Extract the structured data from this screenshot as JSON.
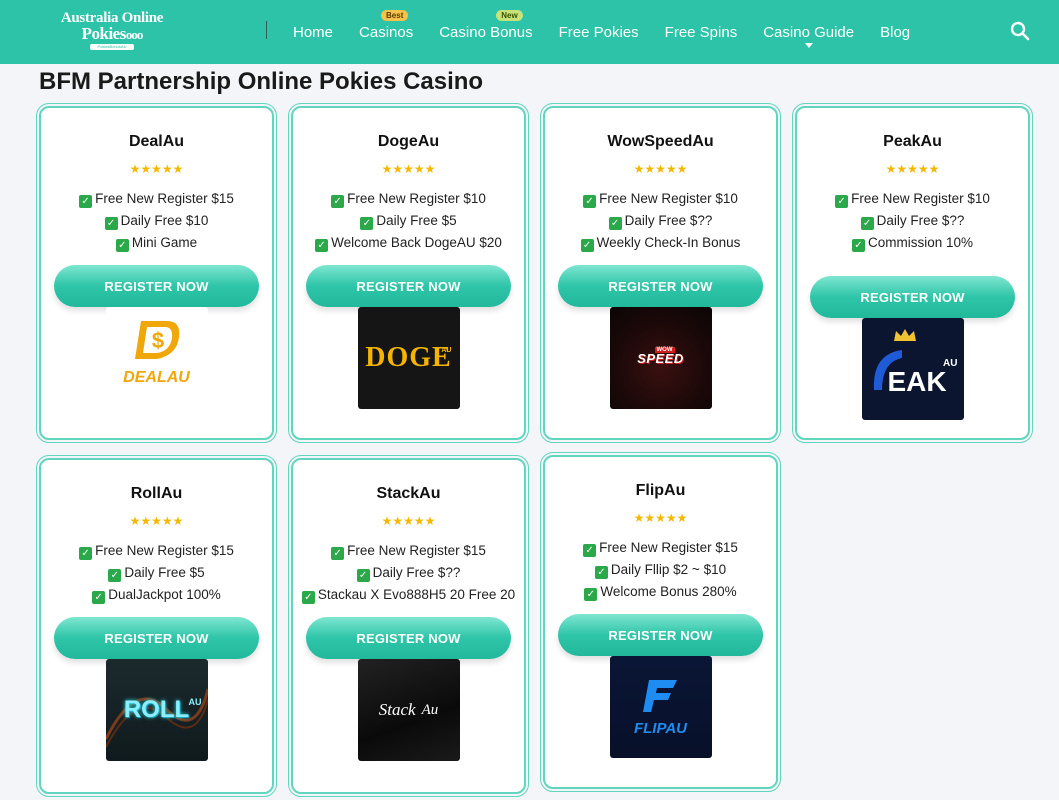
{
  "header": {
    "logo": {
      "line1": "Australia Online",
      "line2": "Pokies",
      "dots": "ooo",
      "tagline": "PokiesBonusAU"
    },
    "nav": [
      {
        "label": "Home",
        "badge": ""
      },
      {
        "label": "Casinos",
        "badge": "Best"
      },
      {
        "label": "Casino Bonus",
        "badge": "New"
      },
      {
        "label": "Free Pokies",
        "badge": ""
      },
      {
        "label": "Free Spins",
        "badge": ""
      },
      {
        "label": "Casino Guide",
        "badge": ""
      },
      {
        "label": "Blog",
        "badge": ""
      }
    ]
  },
  "page_title": "BFM Partnership Online Pokies Casino",
  "stars": "★★★★★",
  "check": "✓",
  "register_label": "REGISTER NOW",
  "cards": [
    {
      "name": "DealAu",
      "features": [
        "Free New Register $15",
        "Daily Free $10",
        "Mini Game"
      ],
      "logo_text": "DEALAU"
    },
    {
      "name": "DogeAu",
      "features": [
        "Free New Register $10",
        "Daily Free $5",
        "Welcome Back DogeAU $20"
      ],
      "logo_text": "DOGE",
      "logo_sup": "AU"
    },
    {
      "name": "WowSpeedAu",
      "features": [
        "Free New Register $10",
        "Daily Free $??",
        "Weekly Check-In Bonus"
      ],
      "logo_text": "SPEED",
      "logo_small": "WOW"
    },
    {
      "name": "PeakAu",
      "features": [
        "Free New Register $10",
        "Daily Free $??",
        "Commission 10%"
      ],
      "logo_text": "EAK",
      "logo_sup": "AU"
    },
    {
      "name": "RollAu",
      "features": [
        "Free New Register $15",
        "Daily Free $5",
        "DualJackpot 100%"
      ],
      "logo_text": "ROLL",
      "logo_sup": "AU"
    },
    {
      "name": "StackAu",
      "features": [
        "Free New Register $15",
        "Daily Free $??",
        "Stackau X Evo888H5 20 Free 20"
      ],
      "logo_text": "Stack",
      "logo_sup": "Au"
    },
    {
      "name": "FlipAu",
      "features": [
        "Free New Register $15",
        "Daily Fllip $2 ~ $10",
        "Welcome Bonus 280%"
      ],
      "logo_text": "FLIPAU"
    }
  ],
  "colors": {
    "brand": "#2cc3a8",
    "card_border": "#5fd6bd",
    "star": "#f5b800",
    "check_green": "#2aa84a"
  }
}
